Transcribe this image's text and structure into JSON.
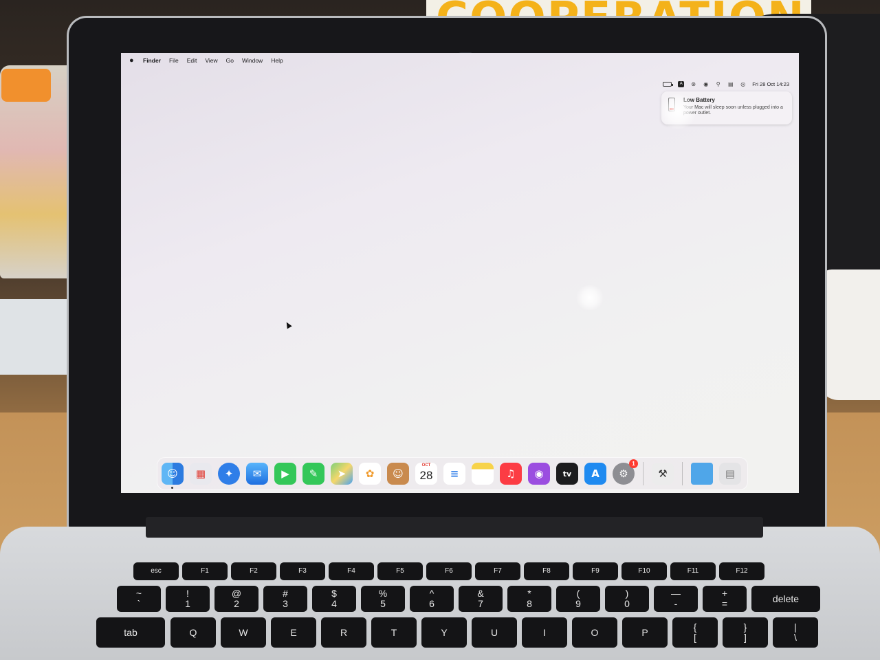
{
  "background": {
    "poster_text": "COOPERATION"
  },
  "menubar": {
    "apple_icon": "",
    "app_name": "Finder",
    "items": [
      "File",
      "Edit",
      "View",
      "Go",
      "Window",
      "Help"
    ]
  },
  "status_bar": {
    "input_source": "A",
    "datetime": "Fri 28 Oct  14:23"
  },
  "notification": {
    "title": "Low Battery",
    "body": "Your Mac will sleep soon unless plugged into a power outlet."
  },
  "dock": {
    "apps": [
      {
        "name": "Finder",
        "icon": "finder-icon",
        "running": true
      },
      {
        "name": "Launchpad",
        "icon": "launchpad-icon"
      },
      {
        "name": "Safari",
        "icon": "safari-icon"
      },
      {
        "name": "Mail",
        "icon": "mail-icon"
      },
      {
        "name": "FaceTime",
        "icon": "facetime-icon"
      },
      {
        "name": "Messages",
        "icon": "messages-icon"
      },
      {
        "name": "Maps",
        "icon": "maps-icon"
      },
      {
        "name": "Photos",
        "icon": "photos-icon"
      },
      {
        "name": "Contacts",
        "icon": "contacts-icon"
      },
      {
        "name": "Calendar",
        "icon": "calendar-icon",
        "month": "OCT",
        "day": "28"
      },
      {
        "name": "Reminders",
        "icon": "reminders-icon"
      },
      {
        "name": "Notes",
        "icon": "notes-icon"
      },
      {
        "name": "Music",
        "icon": "music-icon"
      },
      {
        "name": "Podcasts",
        "icon": "podcasts-icon"
      },
      {
        "name": "TV",
        "icon": "tv-icon",
        "label": "tv"
      },
      {
        "name": "App Store",
        "icon": "app-store-icon"
      },
      {
        "name": "System Preferences",
        "icon": "settings-icon",
        "badge": "1"
      },
      {
        "name": "Utility",
        "icon": "utility-icon"
      },
      {
        "name": "Downloads",
        "icon": "folder-icon"
      },
      {
        "name": "Trash",
        "icon": "trash-icon"
      }
    ]
  },
  "keyboard": {
    "fn_row": [
      "esc",
      "F1",
      "F2",
      "F3",
      "F4",
      "F5",
      "F6",
      "F7",
      "F8",
      "F9",
      "F10",
      "F11",
      "F12"
    ],
    "number_row": [
      "~\n`",
      "!\n1",
      "@\n2",
      "#\n3",
      "$\n4",
      "%\n5",
      "^\n6",
      "&\n7",
      "*\n8",
      "(\n9",
      ")\n0",
      "—\n-",
      "+\n=",
      "delete"
    ],
    "top_row": [
      "tab",
      "Q",
      "W",
      "E",
      "R",
      "T",
      "Y",
      "U",
      "I",
      "O",
      "P",
      "{\n[",
      "}\n]",
      "|\n\\"
    ]
  }
}
